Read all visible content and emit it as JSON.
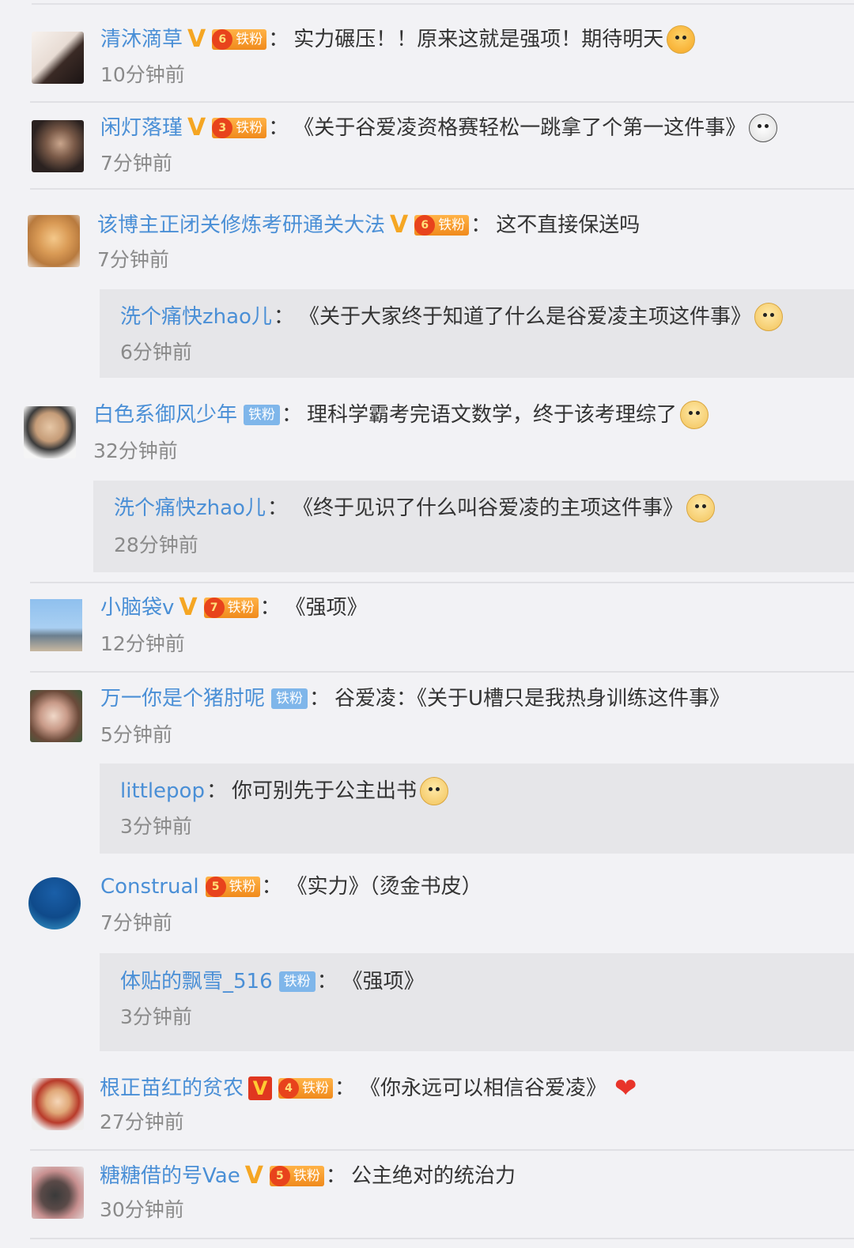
{
  "comments": [
    {
      "user": "清沐滴草",
      "text": "实力碾压！！原来这就是强项！期待明天",
      "time": "10分钟前",
      "fan_label": "铁粉",
      "fan_level": "6"
    },
    {
      "user": "闲灯落瑾",
      "text": "《关于谷爱凌资格赛轻松一跳拿了个第一这件事》",
      "time": "7分钟前",
      "fan_label": "铁粉",
      "fan_level": "3"
    },
    {
      "user": "该博主正闭关修炼考研通关大法",
      "text": "这不直接保送吗",
      "time": "7分钟前",
      "fan_label": "铁粉",
      "fan_level": "6",
      "reply": {
        "user": "洗个痛快zhao儿",
        "text": "《关于大家终于知道了什么是谷爱凌主项这件事》",
        "time": "6分钟前"
      }
    },
    {
      "user": "白色系御风少年",
      "text": "理科学霸考完语文数学，终于该考理综了",
      "time": "32分钟前",
      "fan_label": "铁粉",
      "reply": {
        "user": "洗个痛快zhao儿",
        "text": "《终于见识了什么叫谷爱凌的主项这件事》",
        "time": "28分钟前"
      }
    },
    {
      "user": "小脑袋v",
      "text": "《强项》",
      "time": "12分钟前",
      "fan_label": "铁粉",
      "fan_level": "7"
    },
    {
      "user": "万一你是个猪肘呢",
      "text": "谷爱凌：《关于U槽只是我热身训练这件事》",
      "time": "5分钟前",
      "fan_label": "铁粉",
      "reply": {
        "user": "littlepop",
        "text": "你可别先于公主出书",
        "time": "3分钟前"
      }
    },
    {
      "user": "Construal",
      "text": "《实力》（烫金书皮）",
      "time": "7分钟前",
      "fan_label": "铁粉",
      "fan_level": "5",
      "reply": {
        "user": "体贴的飘雪_516",
        "text": "《强项》",
        "time": "3分钟前",
        "fan_label": "铁粉"
      }
    },
    {
      "user": "根正苗红的贫农",
      "text": "《你永远可以相信谷爱凌》",
      "time": "27分钟前",
      "fan_label": "铁粉",
      "fan_level": "4"
    },
    {
      "user": "糖糖借的号Vae",
      "text": "公主绝对的统治力",
      "time": "30分钟前",
      "fan_label": "铁粉",
      "fan_level": "5"
    }
  ],
  "colors": {
    "username": "#4a8fd6",
    "time": "#8a8a8a",
    "background": "#f2f2f5",
    "reply_bg": "#e6e6e9",
    "v_badge": "#f5a623",
    "heart": "#e8342a"
  },
  "icons": [
    "verified-v-icon",
    "fan-crown-badge",
    "doge-emoji",
    "kiss-emoji",
    "panda-emoji",
    "heart-icon"
  ]
}
